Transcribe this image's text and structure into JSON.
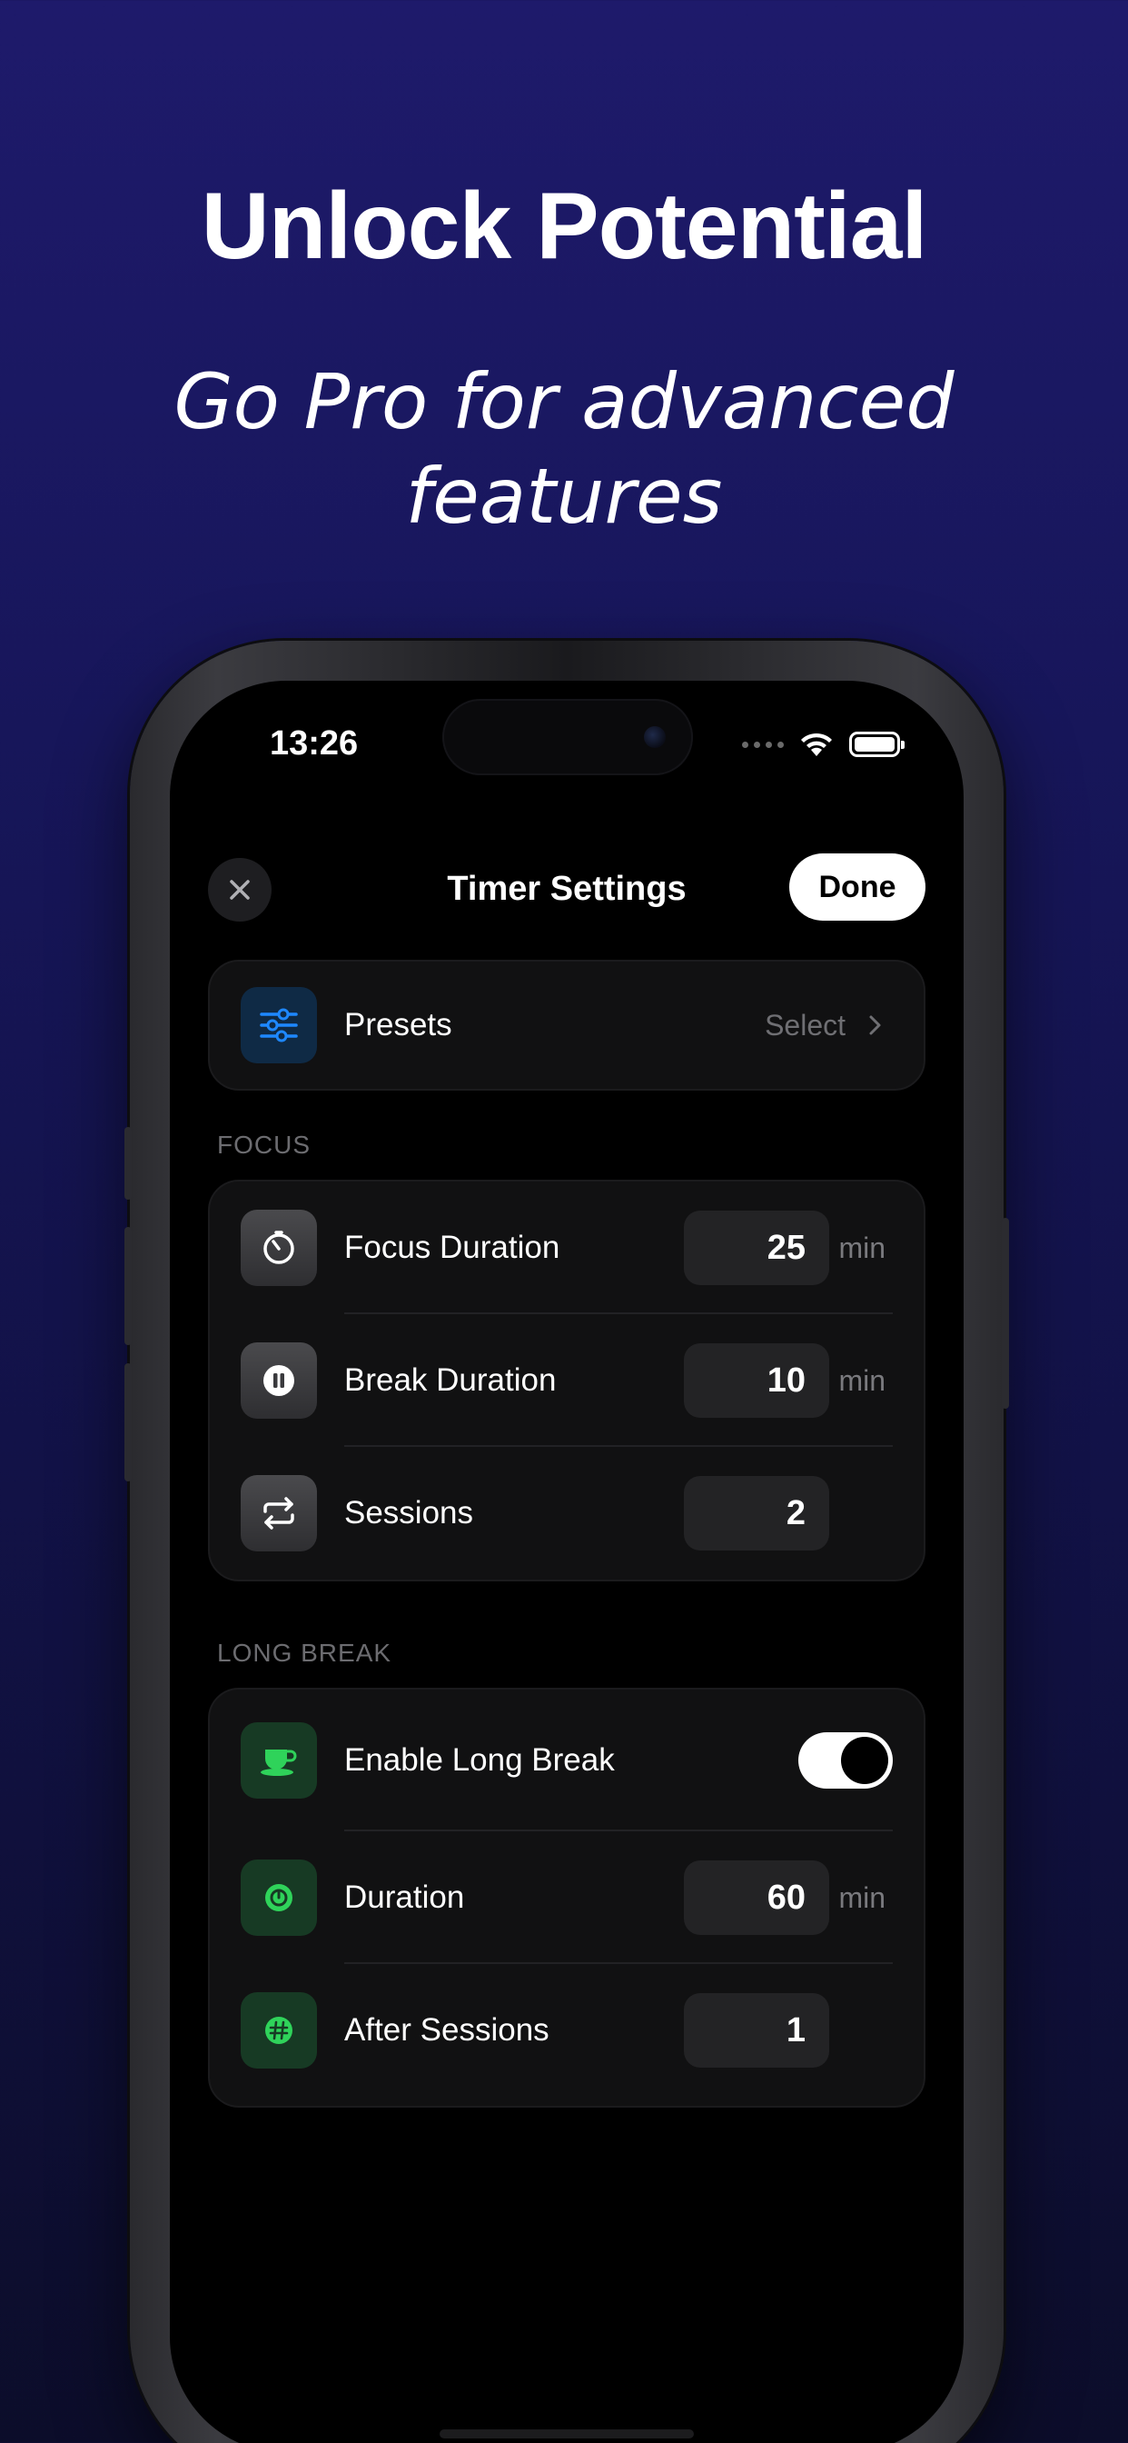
{
  "marketing": {
    "headline": "Unlock Potential",
    "subheadline": "Go Pro for advanced features"
  },
  "status_bar": {
    "time": "13:26",
    "icons": [
      "signal-dots-icon",
      "wifi-icon",
      "battery-icon"
    ],
    "battery_level": 1.0
  },
  "nav": {
    "title": "Timer Settings",
    "done_label": "Done",
    "close_icon": "close-icon"
  },
  "presets": {
    "label": "Presets",
    "action": "Select",
    "icon": "sliders-icon"
  },
  "focus": {
    "section_label": "FOCUS",
    "rows": [
      {
        "label": "Focus Duration",
        "value": "25",
        "unit": "min",
        "icon": "timer-icon"
      },
      {
        "label": "Break Duration",
        "value": "10",
        "unit": "min",
        "icon": "pause-icon"
      },
      {
        "label": "Sessions",
        "value": "2",
        "unit": "",
        "icon": "repeat-icon"
      }
    ]
  },
  "long_break": {
    "section_label": "LONG BREAK",
    "enable_label": "Enable Long Break",
    "enable_on": true,
    "enable_icon": "coffee-cup-icon",
    "rows": [
      {
        "label": "Duration",
        "value": "60",
        "unit": "min",
        "icon": "stopwatch-icon"
      },
      {
        "label": "After Sessions",
        "value": "1",
        "unit": "",
        "icon": "hash-icon"
      }
    ]
  },
  "colors": {
    "background_top": "#1e1a6b",
    "background_bottom": "#0c0d2a",
    "accent_blue": "#1e88ff",
    "accent_green": "#2fd35a",
    "card": "#111112",
    "field": "#232325"
  }
}
